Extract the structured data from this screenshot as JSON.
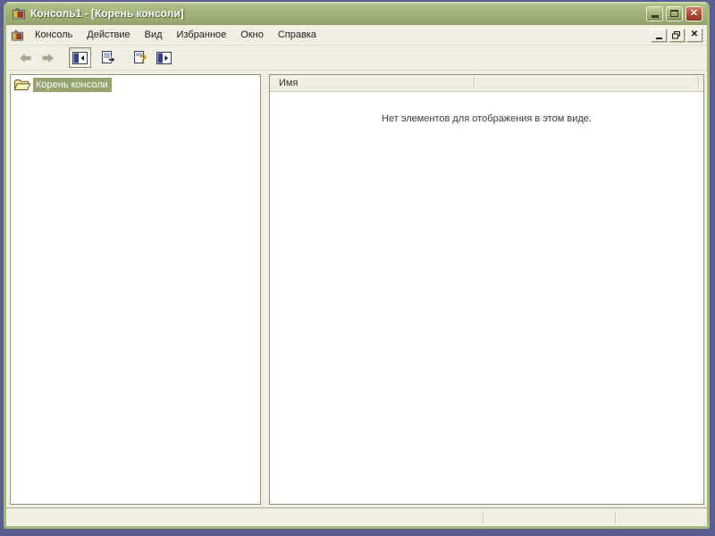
{
  "window": {
    "title": "Консоль1 - [Корень консоли]"
  },
  "menu_bar": {
    "items": [
      {
        "label": "Консоль"
      },
      {
        "label": "Действие"
      },
      {
        "label": "Вид"
      },
      {
        "label": "Избранное"
      },
      {
        "label": "Окно"
      },
      {
        "label": "Справка"
      }
    ]
  },
  "toolbar": {
    "buttons": [
      {
        "name": "back",
        "enabled": false
      },
      {
        "name": "forward",
        "enabled": false
      },
      {
        "name": "toggle-console-tree",
        "pressed": true
      },
      {
        "name": "export-list",
        "enabled": true
      },
      {
        "name": "help",
        "enabled": true
      },
      {
        "name": "show-action-pane",
        "enabled": true
      }
    ]
  },
  "tree": {
    "items": [
      {
        "label": "Корень консоли",
        "selected": true
      }
    ]
  },
  "list": {
    "columns": [
      {
        "label": "Имя"
      }
    ],
    "empty_message": "Нет элементов для отображения в этом виде."
  },
  "colors": {
    "desktop": "#5a5f93",
    "titlebar": "#9fb175",
    "chrome": "#f1efe2",
    "tree_selection": "#93a46c",
    "close_button": "#b34a38"
  }
}
